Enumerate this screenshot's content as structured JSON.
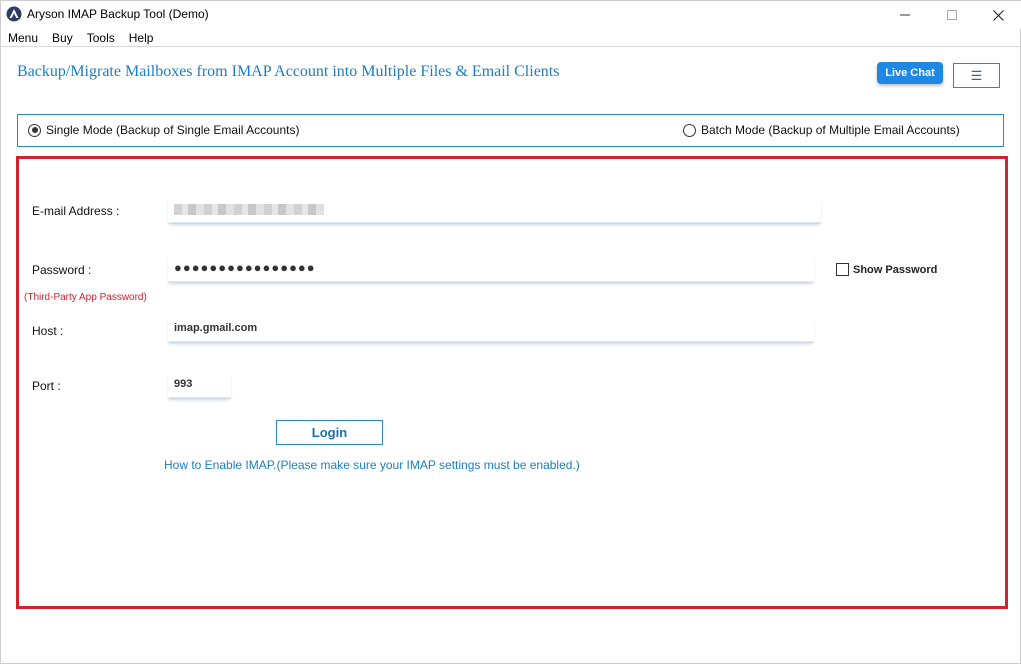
{
  "window": {
    "title": "Aryson IMAP Backup Tool (Demo)",
    "controls": {
      "minimize": "—",
      "maximize": "☐",
      "close": "✕"
    }
  },
  "menu": {
    "items": [
      "Menu",
      "Buy",
      "Tools",
      "Help"
    ]
  },
  "header": {
    "heading": "Backup/Migrate Mailboxes from IMAP Account into Multiple Files & Email Clients",
    "live_chat": "Live Chat",
    "hamburger": "☰"
  },
  "mode": {
    "single": "Single Mode (Backup of Single Email Accounts)",
    "batch": "Batch Mode (Backup of Multiple Email Accounts)",
    "selected": "single"
  },
  "form": {
    "email_label": "E-mail Address :",
    "email_value": "",
    "password_label": "Password :",
    "password_hint": "(Third-Party App Password)",
    "password_value": "●●●●●●●●●●●●●●●●",
    "show_password": "Show Password",
    "host_label": "Host :",
    "host_value": "imap.gmail.com",
    "port_label": "Port :",
    "port_value": "993",
    "login": "Login",
    "help_link": "How to Enable IMAP.(Please make sure your IMAP settings must be enabled.)"
  },
  "colors": {
    "accent": "#1a7fc4",
    "panel_border": "#d4202f",
    "live_chat_bg": "#1e88e5"
  }
}
